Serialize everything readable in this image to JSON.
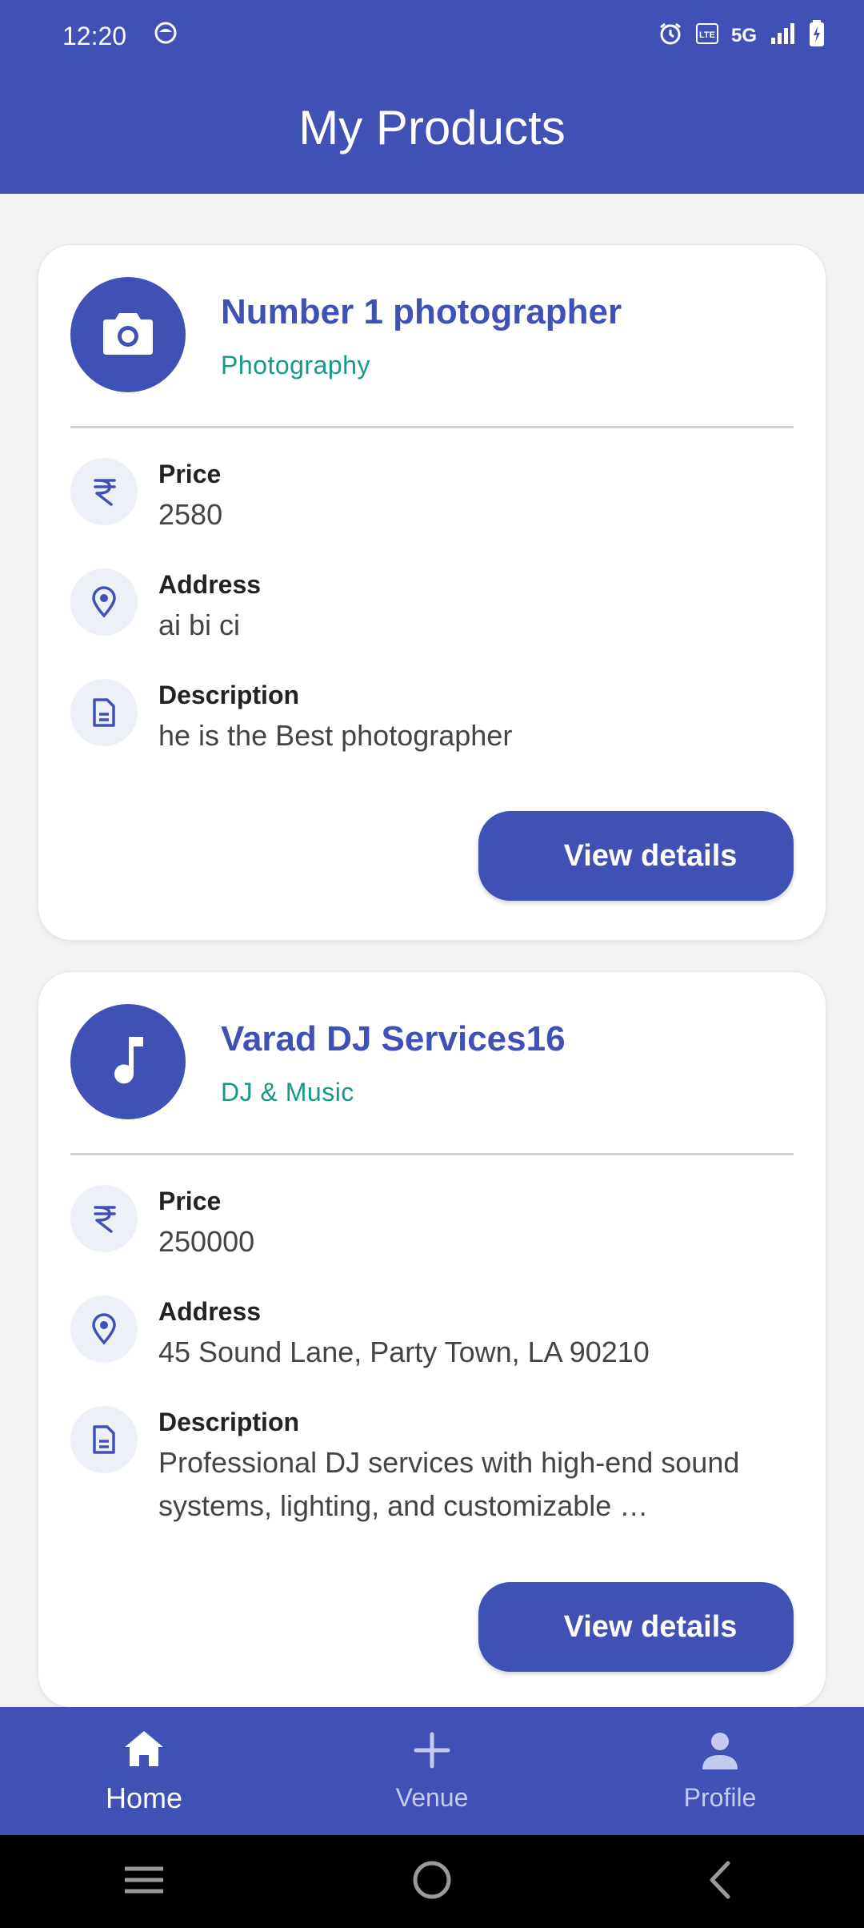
{
  "status_bar": {
    "time": "12:20",
    "signal_text": "5G"
  },
  "app_bar": {
    "title": "My Products"
  },
  "products": [
    {
      "name": "Number 1 photographer",
      "category": "Photography",
      "icon": "camera-icon",
      "price_label": "Price",
      "price": "2580",
      "address_label": "Address",
      "address": "ai bi ci",
      "description_label": "Description",
      "description": "he is the Best photographer",
      "button_label": "View details"
    },
    {
      "name": "Varad DJ Services16",
      "category": "DJ & Music",
      "icon": "music-note-icon",
      "price_label": "Price",
      "price": "250000",
      "address_label": "Address",
      "address": "45 Sound Lane, Party Town, LA 90210",
      "description_label": "Description",
      "description": "Professional DJ services with high-end sound systems, lighting, and customizable …",
      "button_label": "View details"
    }
  ],
  "bottom_nav": {
    "items": [
      {
        "label": "Home",
        "icon": "home-icon",
        "active": true
      },
      {
        "label": "Venue",
        "icon": "plus-icon",
        "active": false
      },
      {
        "label": "Profile",
        "icon": "person-icon",
        "active": false
      }
    ]
  },
  "colors": {
    "primary": "#3f51b5",
    "accent_text": "#169a88",
    "background": "#f3f3f3"
  }
}
